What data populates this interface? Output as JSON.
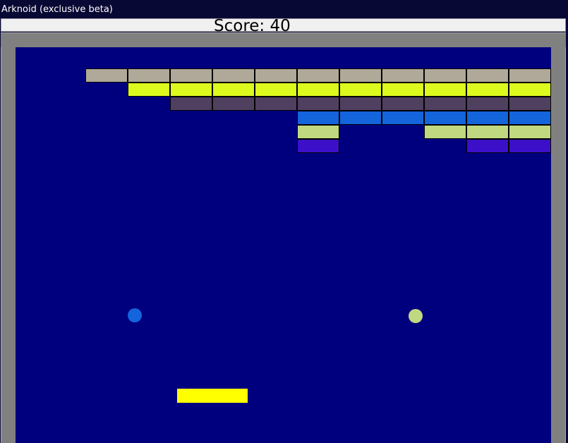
{
  "window": {
    "title": "Arknoid (exclusive beta)"
  },
  "hud": {
    "score_text": "Score: 40",
    "score_label": "Score",
    "score": 40
  },
  "colors": {
    "background": "#00007f",
    "wall": "#808080",
    "paddle": "#ffff00",
    "row_colors": [
      "#b0a898",
      "#dcfa1e",
      "#504060",
      "#1464dc",
      "#c0d880",
      "#3c10c8"
    ]
  },
  "bricks": {
    "columns": 11,
    "rows": [
      {
        "color": "#b0a898",
        "present": [
          true,
          true,
          true,
          true,
          true,
          true,
          true,
          true,
          true,
          true,
          true
        ]
      },
      {
        "color": "#dcfa1e",
        "present": [
          false,
          true,
          true,
          true,
          true,
          true,
          true,
          true,
          true,
          true,
          true
        ]
      },
      {
        "color": "#504060",
        "present": [
          false,
          false,
          true,
          true,
          true,
          true,
          true,
          true,
          true,
          true,
          true
        ]
      },
      {
        "color": "#1464dc",
        "present": [
          false,
          false,
          false,
          false,
          false,
          true,
          true,
          true,
          true,
          true,
          true
        ]
      },
      {
        "color": "#c0d880",
        "present": [
          false,
          false,
          false,
          false,
          false,
          true,
          false,
          false,
          true,
          true,
          true
        ]
      },
      {
        "color": "#3c10c8",
        "present": [
          false,
          false,
          false,
          false,
          false,
          true,
          false,
          false,
          false,
          true,
          true
        ]
      }
    ]
  },
  "balls": [
    {
      "name": "ball-blue",
      "color": "#1464dc"
    },
    {
      "name": "ball-green",
      "color": "#c0d880"
    }
  ],
  "paddle": {
    "color": "#ffff00"
  }
}
